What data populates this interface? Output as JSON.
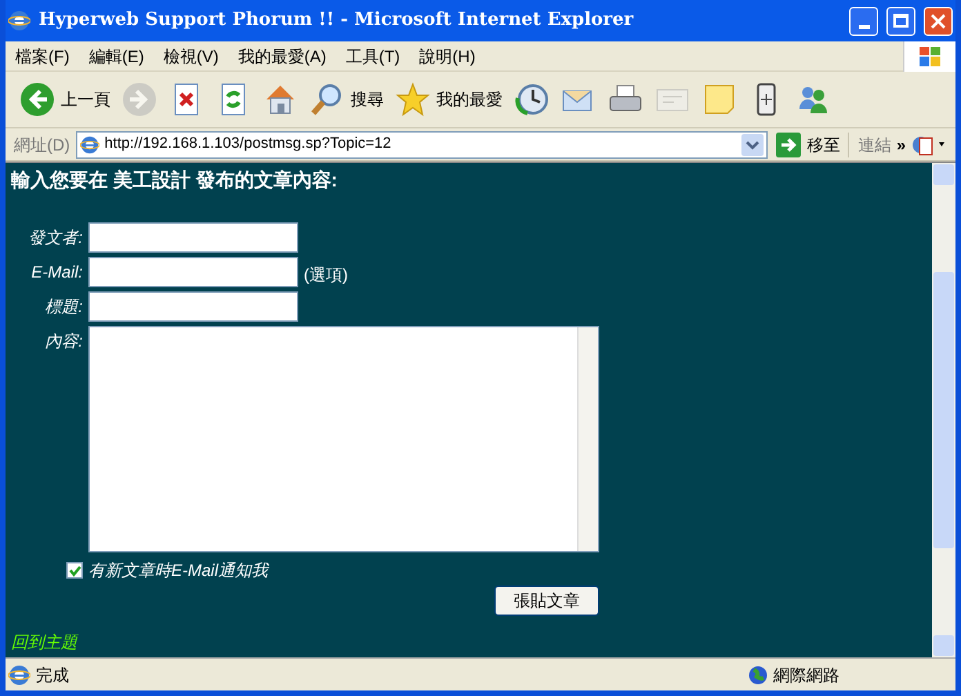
{
  "window": {
    "title": "Hyperweb Support Phorum !! - Microsoft Internet Explorer"
  },
  "menu": [
    "檔案(F)",
    "編輯(E)",
    "檢視(V)",
    "我的最愛(A)",
    "工具(T)",
    "說明(H)"
  ],
  "toolbar": [
    {
      "kind": "back",
      "label": "上一頁",
      "disabled": false
    },
    {
      "kind": "forward",
      "disabled": true
    },
    {
      "kind": "stop",
      "disabled": false
    },
    {
      "kind": "refresh",
      "disabled": false
    },
    {
      "kind": "home",
      "disabled": false
    },
    {
      "kind": "search",
      "label": "搜尋",
      "disabled": false
    },
    {
      "kind": "favorites",
      "label": "我的最愛",
      "disabled": false
    },
    {
      "kind": "history",
      "disabled": false
    },
    {
      "kind": "mail",
      "disabled": false
    },
    {
      "kind": "print",
      "disabled": false
    },
    {
      "kind": "edit",
      "disabled": true
    },
    {
      "kind": "note",
      "disabled": false
    },
    {
      "kind": "device",
      "disabled": false
    },
    {
      "kind": "messenger",
      "disabled": false
    }
  ],
  "address": {
    "label": "網址(D)",
    "url": "http://192.168.1.103/postmsg.sp?Topic=12",
    "go": "移至",
    "links": "連結",
    "chevron": "»"
  },
  "page": {
    "heading": "輸入您要在 美工設計 發布的文章內容:",
    "fields": [
      {
        "label": "發文者:",
        "kind": "text"
      },
      {
        "label": "E-Mail:",
        "kind": "text",
        "note": "(選項)"
      },
      {
        "label": "標題:",
        "kind": "text"
      },
      {
        "label": "內容:",
        "kind": "textarea"
      }
    ],
    "notify": {
      "label": "有新文章時E-Mail通知我",
      "checked": true
    },
    "submit": "張貼文章",
    "back_link": "回到主題"
  },
  "status_bar": {
    "text": "完成",
    "zone": "網際網路"
  }
}
